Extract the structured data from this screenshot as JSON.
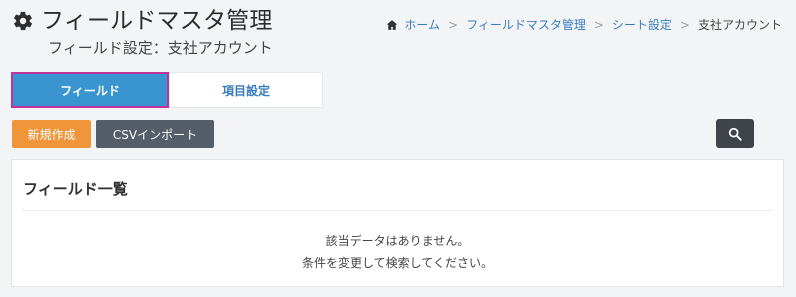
{
  "header": {
    "title": "フィールドマスタ管理",
    "subtitle": "フィールド設定：支社アカウント",
    "title_icon": "gear-icon"
  },
  "breadcrumb": {
    "home_icon": "home-icon",
    "items": [
      "ホーム",
      "フィールドマスタ管理",
      "シート設定",
      "支社アカウント"
    ],
    "separator": ">"
  },
  "tabs": [
    {
      "label": "フィールド",
      "active": true
    },
    {
      "label": "項目設定",
      "active": false
    }
  ],
  "toolbar": {
    "new_label": "新規作成",
    "csv_import_label": "CSVインポート",
    "search_icon": "search-icon"
  },
  "panel": {
    "title": "フィールド一覧",
    "empty_line1": "該当データはありません。",
    "empty_line2": "条件を変更して検索してください。"
  },
  "colors": {
    "active_tab": "#3a94d0",
    "active_tab_border": "#c1329e",
    "new_button": "#f1953a",
    "csv_button": "#555d69",
    "search_button": "#3f444b",
    "link": "#3a7dbf"
  }
}
